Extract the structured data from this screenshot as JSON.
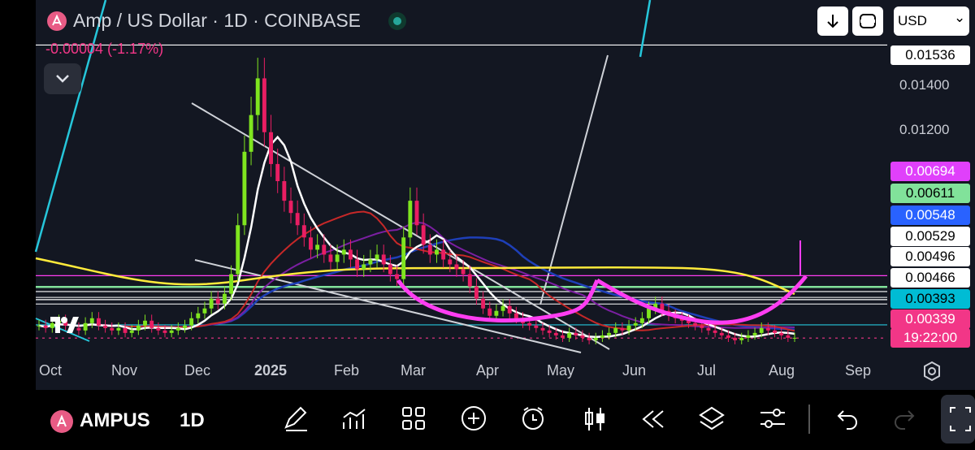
{
  "legend": {
    "symbol_title": "Amp / US Dollar · 1D · COINBASE",
    "change": "-0.00004 (-1.17%)"
  },
  "toolbar_top": {
    "currency": "USD",
    "currency_chevron": "⌄"
  },
  "price_axis": {
    "ticks": [
      "0.01400",
      "0.01200"
    ],
    "labels": [
      {
        "value": "0.01536",
        "bg": "#ffffff",
        "fg": "#000000"
      },
      {
        "value": "0.00694",
        "bg": "#e040fb",
        "fg": "#ffffff"
      },
      {
        "value": "0.00611",
        "bg": "#81e29a",
        "fg": "#000000"
      },
      {
        "value": "0.00548",
        "bg": "#2962ff",
        "fg": "#ffffff"
      },
      {
        "value": "0.00529",
        "bg": "#ffffff",
        "fg": "#000000"
      },
      {
        "value": "0.00496",
        "bg": "#ffffff",
        "fg": "#000000"
      },
      {
        "value": "0.00466",
        "bg": "#ffffff",
        "fg": "#000000"
      },
      {
        "value": "0.00393",
        "bg": "#00bcd4",
        "fg": "#000000"
      },
      {
        "value": "0.00339",
        "bg": "#f23687",
        "fg": "#ffffff"
      }
    ],
    "countdown": "19:22:00"
  },
  "time_axis": [
    "Oct",
    "Nov",
    "Dec",
    "2025",
    "Feb",
    "Mar",
    "Apr",
    "May",
    "Jun",
    "Jul",
    "Aug",
    "Sep"
  ],
  "bottom_bar": {
    "symbol": "AMPUS",
    "interval": "1D"
  },
  "colors": {
    "background": "#131722",
    "up": "#7fe51f",
    "down": "#e91e63",
    "sma_white": "#ffffff",
    "sma_yellow": "#ffeb3b",
    "sma_red": "#c62828",
    "sma_purple": "#7b1fa2",
    "sma_blue": "#1e3fb8",
    "curve": "#ff3df2"
  },
  "chart_data": {
    "type": "candlestick",
    "title": "Amp / US Dollar · 1D · COINBASE",
    "ylim": [
      0.0026,
      0.0172
    ],
    "x_axis_labels": [
      "Oct",
      "Nov",
      "Dec",
      "2025",
      "Feb",
      "Mar",
      "Apr",
      "May",
      "Jun",
      "Jul",
      "Aug",
      "Sep"
    ],
    "last_price": 0.00339,
    "change": -4e-05,
    "change_percent": -1.17,
    "horizontal_levels": [
      0.01536,
      0.00529,
      0.00496,
      0.00466,
      0.00393,
      0.00339
    ],
    "indicator_values": {
      "white": 0.00694,
      "green": 0.00611,
      "blue": 0.00548
    },
    "close_series": [
      0.0039,
      0.0038,
      0.004,
      0.0041,
      0.0039,
      0.0038,
      0.0037,
      0.004,
      0.0042,
      0.0039,
      0.0038,
      0.0037,
      0.0038,
      0.0036,
      0.0037,
      0.0039,
      0.0041,
      0.0038,
      0.0037,
      0.0036,
      0.0037,
      0.0038,
      0.0039,
      0.0042,
      0.0044,
      0.0046,
      0.005,
      0.0048,
      0.0052,
      0.006,
      0.008,
      0.011,
      0.0125,
      0.014,
      0.0118,
      0.0105,
      0.0098,
      0.009,
      0.0085,
      0.008,
      0.0075,
      0.007,
      0.0072,
      0.0068,
      0.0065,
      0.0068,
      0.007,
      0.0066,
      0.0062,
      0.0064,
      0.0066,
      0.0068,
      0.0064,
      0.006,
      0.0058,
      0.0075,
      0.009,
      0.008,
      0.0072,
      0.0068,
      0.007,
      0.0066,
      0.0064,
      0.0062,
      0.006,
      0.0055,
      0.005,
      0.0046,
      0.0043,
      0.0045,
      0.0047,
      0.0044,
      0.0042,
      0.004,
      0.0039,
      0.0038,
      0.0037,
      0.0036,
      0.0035,
      0.0034,
      0.0036,
      0.0035,
      0.0034,
      0.0033,
      0.0034,
      0.0035,
      0.0036,
      0.0038,
      0.0037,
      0.0039,
      0.004,
      0.0042,
      0.0046,
      0.0048,
      0.0045,
      0.0043,
      0.0042,
      0.0041,
      0.004,
      0.0039,
      0.0038,
      0.0037,
      0.0036,
      0.0035,
      0.0034,
      0.0033,
      0.0034,
      0.0035,
      0.0036,
      0.0038,
      0.0037,
      0.0036,
      0.0035,
      0.0034,
      0.0034
    ]
  }
}
